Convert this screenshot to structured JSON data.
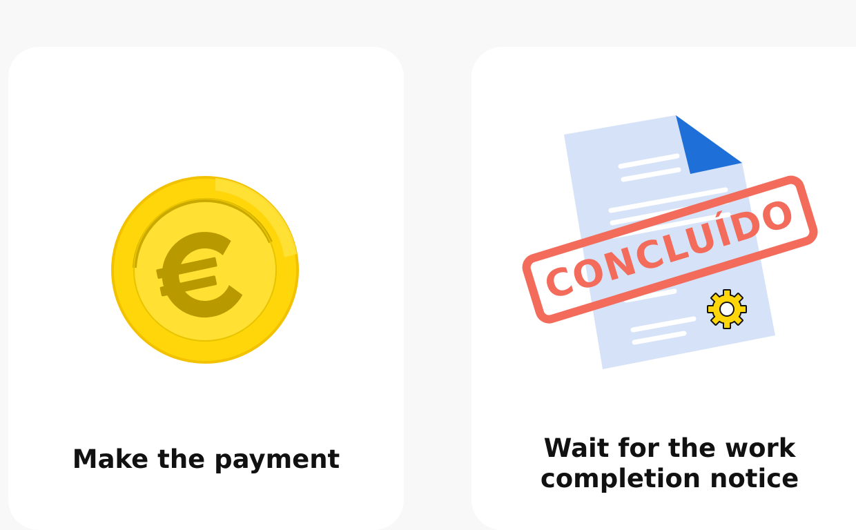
{
  "steps": [
    {
      "title": "Make the payment",
      "icon": "euro-coin-icon"
    },
    {
      "title_lines": [
        "Wait for the work",
        "completion notice"
      ],
      "icon": "completed-document-icon",
      "stamp_text": "CONCLUÍDO"
    }
  ],
  "colors": {
    "page_background": "#f8f8f8",
    "card_background": "#ffffff",
    "coin_gold": "#ffd60a",
    "coin_symbol": "#b89a00",
    "document_blue": "#d6e2f7",
    "document_corner": "#1f6fd9",
    "stamp_red": "#f26b5b",
    "gear_yellow": "#ffd60a"
  }
}
